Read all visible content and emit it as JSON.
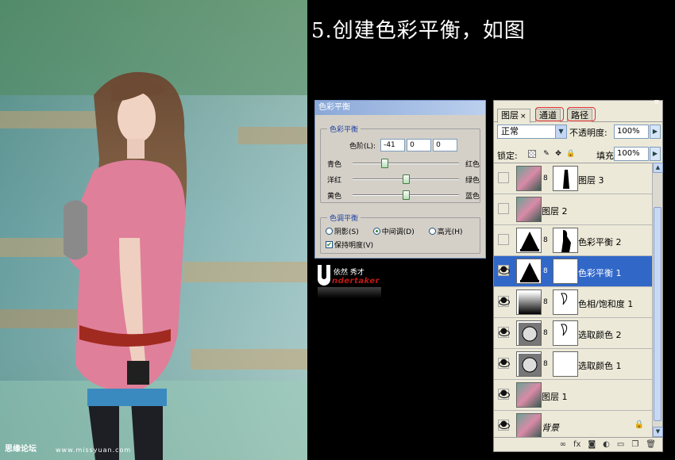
{
  "heading": "5.创建色彩平衡，如图",
  "watermark": {
    "site_name": "思缘论坛",
    "url": "www.missyuan.com"
  },
  "color_balance": {
    "title": "色彩平衡",
    "group_balance_label": "色彩平衡",
    "levels_label": "色阶(L):",
    "levels": [
      "-41",
      "0",
      "0"
    ],
    "sliders": [
      {
        "left": "青色",
        "right": "红色",
        "value": -41
      },
      {
        "left": "洋红",
        "right": "绿色",
        "value": 0
      },
      {
        "left": "黄色",
        "right": "蓝色",
        "value": 0
      }
    ],
    "group_tone_label": "色调平衡",
    "tones": [
      {
        "label": "阴影(S)",
        "selected": false
      },
      {
        "label": "中间调(D)",
        "selected": true
      },
      {
        "label": "高光(H)",
        "selected": false
      }
    ],
    "preserve_luminosity_label": "保持明度(V)",
    "preserve_luminosity_checked": true
  },
  "logo": {
    "letter": "U",
    "slogan": "依然 秀才",
    "brand": "ndertaker"
  },
  "layers_panel": {
    "menu_glyph": "≡",
    "tabs": [
      {
        "label": "图层",
        "close": "×",
        "active": true
      },
      {
        "label": "通道",
        "active": false
      },
      {
        "label": "路径",
        "active": false
      }
    ],
    "blend_mode": "正常",
    "opacity_label": "不透明度:",
    "opacity": "100%",
    "lock_label": "锁定:",
    "fill_label": "填充:",
    "fill": "100%",
    "layers": [
      {
        "name": "图层 3",
        "kind": "photo-mask",
        "visible": false,
        "selected": false
      },
      {
        "name": "图层 2",
        "kind": "photo",
        "visible": false,
        "selected": false
      },
      {
        "name": "色彩平衡 2",
        "kind": "adjust-balance",
        "visible": false,
        "selected": false
      },
      {
        "name": "色彩平衡 1",
        "kind": "adjust-balance",
        "visible": true,
        "selected": true
      },
      {
        "name": "色相/饱和度 1",
        "kind": "adjust-huesat",
        "visible": true,
        "selected": false
      },
      {
        "name": "选取颜色 2",
        "kind": "adjust-selective",
        "visible": true,
        "selected": false
      },
      {
        "name": "选取颜色 1",
        "kind": "adjust-selective",
        "visible": true,
        "selected": false
      },
      {
        "name": "图层 1",
        "kind": "photo",
        "visible": true,
        "selected": false
      },
      {
        "name": "背景",
        "kind": "background",
        "visible": true,
        "selected": false
      }
    ],
    "footer_icons": [
      "link-icon",
      "fx-icon",
      "mask-icon",
      "adjustment-icon",
      "folder-icon",
      "new-layer-icon",
      "trash-icon"
    ],
    "footer_glyphs": [
      "∞",
      "fx",
      "◙",
      "◐",
      "▭",
      "❐",
      "🗑"
    ]
  }
}
